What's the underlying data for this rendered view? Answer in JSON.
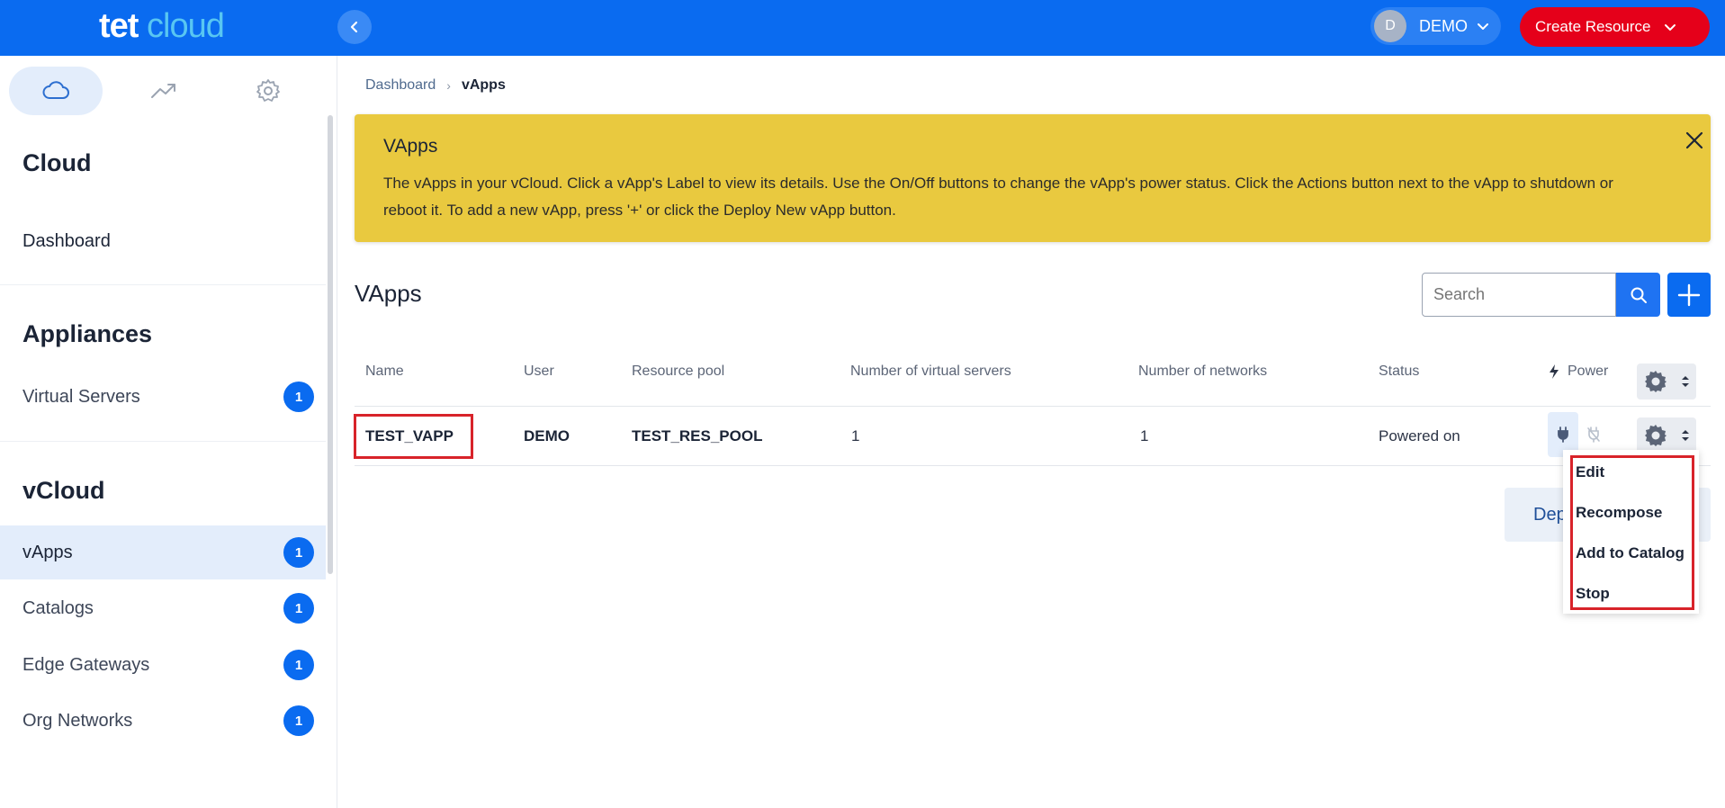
{
  "header": {
    "logo_primary": "tet",
    "logo_secondary": "cloud",
    "user_initial": "D",
    "user_name": "DEMO",
    "create_resource_label": "Create Resource"
  },
  "sidebar": {
    "sections": [
      {
        "title": "Cloud"
      },
      {
        "title": "Appliances"
      },
      {
        "title": "vCloud"
      }
    ],
    "items": [
      {
        "label": "Dashboard"
      },
      {
        "label": "Virtual Servers",
        "badge": "1"
      },
      {
        "label": "vApps",
        "badge": "1",
        "active": true
      },
      {
        "label": "Catalogs",
        "badge": "1"
      },
      {
        "label": "Edge Gateways",
        "badge": "1"
      },
      {
        "label": "Org Networks",
        "badge": "1"
      }
    ]
  },
  "breadcrumb": {
    "parent": "Dashboard",
    "current": "vApps"
  },
  "info_box": {
    "title": "VApps",
    "text": "The vApps in your vCloud. Click a vApp's Label to view its details. Use the On/Off buttons to change the vApp's power status. Click the Actions button next to the vApp to shutdown or reboot it. To add a new vApp, press '+' or click the Deploy New vApp button."
  },
  "main": {
    "title": "VApps",
    "search_placeholder": "Search",
    "deploy_label": "Deploy New vApp"
  },
  "table": {
    "columns": [
      "Name",
      "User",
      "Resource pool",
      "Number of virtual servers",
      "Number of networks",
      "Status",
      "Power"
    ],
    "rows": [
      {
        "name": "TEST_VAPP",
        "user": "DEMO",
        "resource_pool": "TEST_RES_POOL",
        "virtual_servers": "1",
        "networks": "1",
        "status": "Powered on"
      }
    ]
  },
  "actions_menu": {
    "items": [
      "Edit",
      "Recompose",
      "Add to Catalog",
      "Stop"
    ]
  },
  "colors": {
    "primary": "#0a6bf0",
    "danger": "#e5001a",
    "info_banner": "#e9c93f",
    "highlight": "#d8232a"
  }
}
